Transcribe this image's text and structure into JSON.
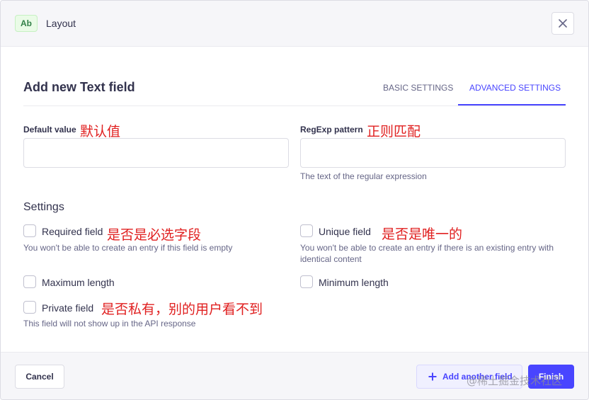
{
  "header": {
    "badge": "Ab",
    "title": "Layout",
    "close_icon": "close-icon"
  },
  "form": {
    "title": "Add new Text field",
    "tabs": [
      {
        "label": "BASIC SETTINGS",
        "active": false
      },
      {
        "label": "ADVANCED SETTINGS",
        "active": true
      }
    ]
  },
  "fields": {
    "default_value": {
      "label": "Default value",
      "annotation": "默认值",
      "value": ""
    },
    "regexp": {
      "label": "RegExp pattern",
      "annotation": "正则匹配",
      "value": "",
      "hint": "The text of the regular expression"
    }
  },
  "settings": {
    "title": "Settings",
    "required": {
      "label": "Required field",
      "annotation": "是否是必选字段",
      "hint": "You won't be able to create an entry if this field is empty",
      "checked": false
    },
    "unique": {
      "label": "Unique field",
      "annotation": "是否是唯一的",
      "hint": "You won't be able to create an entry if there is an existing entry with identical content",
      "checked": false
    },
    "max_length": {
      "label": "Maximum length",
      "checked": false
    },
    "min_length": {
      "label": "Minimum length",
      "checked": false
    },
    "private": {
      "label": "Private field",
      "annotation": "是否私有，别的用户看不到",
      "hint": "This field will not show up in the API response",
      "checked": false
    }
  },
  "footer": {
    "cancel": "Cancel",
    "add_another": "Add another field",
    "add_icon": "plus-icon",
    "finish": "Finish"
  },
  "watermark": "@稀土掘金技术社区",
  "colors": {
    "accent": "#4945ff",
    "annotation": "#e02020",
    "badge_text": "#328048",
    "badge_bg": "#eafbe7"
  }
}
